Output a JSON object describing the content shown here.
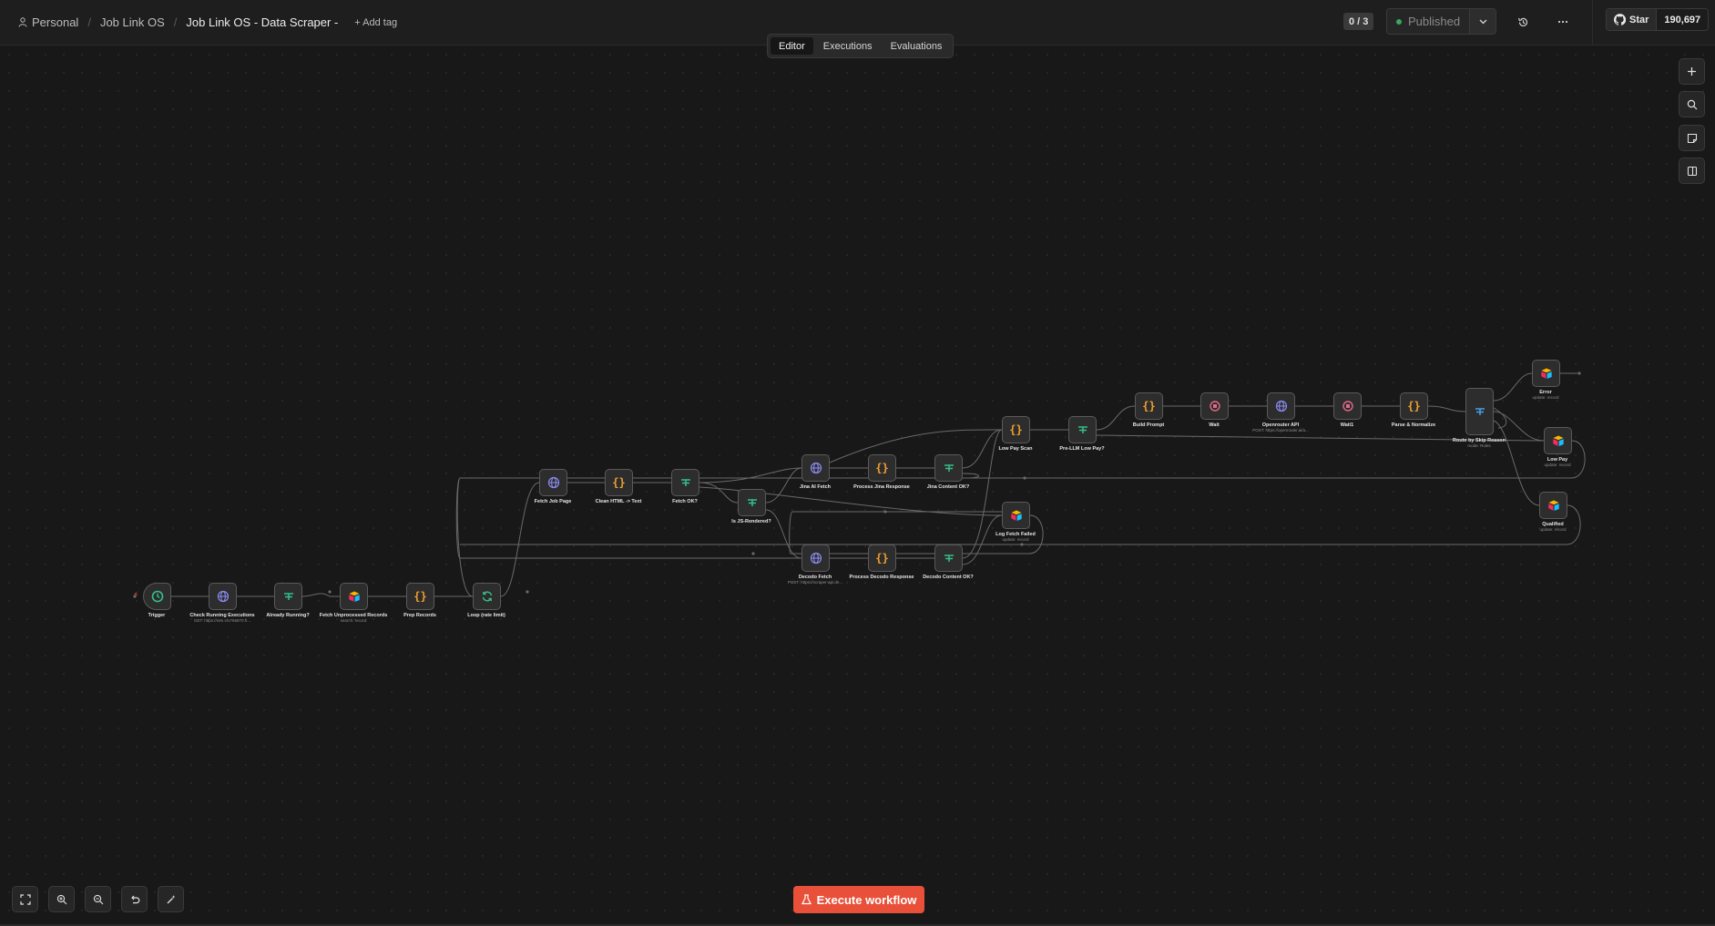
{
  "breadcrumb": {
    "project": "Personal",
    "folder": "Job Link OS",
    "workflow": "Job Link OS - Data Scraper -",
    "add_tag": "+ Add tag"
  },
  "header": {
    "counter": "0 / 3",
    "publish_label": "Published",
    "github_label": "Star",
    "github_count": "190,697"
  },
  "tabs": [
    {
      "label": "Editor",
      "active": true
    },
    {
      "label": "Executions",
      "active": false
    },
    {
      "label": "Evaluations",
      "active": false
    }
  ],
  "execute_button": "Execute workflow",
  "colors": {
    "accent": "#e8503a",
    "published_dot": "#3aa661",
    "code_icon": "#f0a030",
    "http_icon": "#8a8af0",
    "if_icon": "#35c08a",
    "wait_icon": "#e06a8a",
    "loop_icon": "#35c08a",
    "trigger_icon": "#35c08a"
  },
  "nodes": [
    {
      "id": "trigger",
      "label": "Trigger",
      "sub": "",
      "icon": "clock-icon"
    },
    {
      "id": "check",
      "label": "Check Running Executions",
      "sub": "GET: https://n8n.srv766870.h...",
      "icon": "globe-icon"
    },
    {
      "id": "already",
      "label": "Already Running?",
      "sub": "",
      "icon": "if-icon"
    },
    {
      "id": "fetchun",
      "label": "Fetch Unprocessed Records",
      "sub": "search: record",
      "icon": "airtable-icon"
    },
    {
      "id": "prep",
      "label": "Prep Records",
      "sub": "",
      "icon": "code-icon"
    },
    {
      "id": "loop",
      "label": "Loop (rate limit)",
      "sub": "",
      "icon": "loop-icon"
    },
    {
      "id": "fetchjob",
      "label": "Fetch Job Page",
      "sub": "",
      "icon": "globe-icon"
    },
    {
      "id": "clean",
      "label": "Clean HTML -> Text",
      "sub": "",
      "icon": "code-icon"
    },
    {
      "id": "fetchok",
      "label": "Fetch OK?",
      "sub": "",
      "icon": "if-icon"
    },
    {
      "id": "isjs",
      "label": "Is JS-Rendered?",
      "sub": "",
      "icon": "if-icon"
    },
    {
      "id": "jina",
      "label": "Jina AI Fetch",
      "sub": "",
      "icon": "globe-icon"
    },
    {
      "id": "procjina",
      "label": "Process Jina Response",
      "sub": "",
      "icon": "code-icon"
    },
    {
      "id": "jinaok",
      "label": "Jina Content OK?",
      "sub": "",
      "icon": "if-icon"
    },
    {
      "id": "decodo",
      "label": "Decodo Fetch",
      "sub": "POST: https://scraper-api.de...",
      "icon": "globe-icon"
    },
    {
      "id": "procdecodo",
      "label": "Process Decodo Response",
      "sub": "",
      "icon": "code-icon"
    },
    {
      "id": "decodook",
      "label": "Decodo Content OK?",
      "sub": "",
      "icon": "if-icon"
    },
    {
      "id": "logfail",
      "label": "Log Fetch Failed",
      "sub": "update: record",
      "icon": "airtable-icon"
    },
    {
      "id": "lowpay",
      "label": "Low Pay Scan",
      "sub": "",
      "icon": "code-icon"
    },
    {
      "id": "prellm",
      "label": "Pre-LLM Low Pay?",
      "sub": "",
      "icon": "if-icon"
    },
    {
      "id": "build",
      "label": "Build Prompt",
      "sub": "",
      "icon": "code-icon"
    },
    {
      "id": "wait",
      "label": "Wait",
      "sub": "",
      "icon": "wait-icon"
    },
    {
      "id": "openrouter",
      "label": "Openrouter API",
      "sub": "POST: https://openrouter.ai/a...",
      "icon": "globe-icon"
    },
    {
      "id": "wait1",
      "label": "Wait1",
      "sub": "",
      "icon": "wait-icon"
    },
    {
      "id": "parse",
      "label": "Parse & Normalize",
      "sub": "",
      "icon": "code-icon"
    },
    {
      "id": "route",
      "label": "Route by Skip Reason",
      "sub": "mode: Rules",
      "icon": "switch-icon"
    },
    {
      "id": "error",
      "label": "Error",
      "sub": "update: record",
      "icon": "airtable-icon"
    },
    {
      "id": "lowpayout",
      "label": "Low Pay",
      "sub": "update: record",
      "icon": "airtable-icon"
    },
    {
      "id": "qualified",
      "label": "Qualified",
      "sub": "update: record",
      "icon": "airtable-icon"
    }
  ]
}
